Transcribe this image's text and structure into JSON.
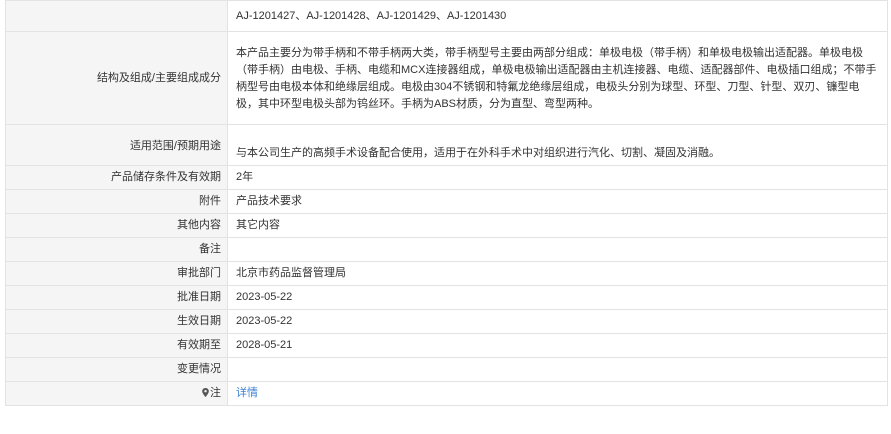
{
  "rows": {
    "model_cont": {
      "label": "",
      "value": "AJ-1201427、AJ-1201428、AJ-1201429、AJ-1201430"
    },
    "structure": {
      "label": "结构及组成/主要组成成分",
      "value": "本产品主要分为带手柄和不带手柄两大类，带手柄型号主要由两部分组成：单极电极（带手柄）和单极电极输出适配器。单极电极（带手柄）由电极、手柄、电缆和MCX连接器组成，单极电极输出适配器由主机连接器、电缆、适配器部件、电极插口组成；不带手柄型号由电极本体和绝缘层组成。电极由304不锈钢和特氟龙绝缘层组成，电极头分别为球型、环型、刀型、针型、双刃、镰型电极，其中环型电极头部为钨丝环。手柄为ABS材质，分为直型、弯型两种。"
    },
    "scope": {
      "label": "适用范围/预期用途",
      "value": "与本公司生产的高频手术设备配合使用，适用于在外科手术中对组织进行汽化、切割、凝固及消融。"
    },
    "storage": {
      "label": "产品储存条件及有效期",
      "value": "2年"
    },
    "attachment": {
      "label": "附件",
      "value": "产品技术要求"
    },
    "other": {
      "label": "其他内容",
      "value": "其它内容"
    },
    "remark": {
      "label": "备注",
      "value": ""
    },
    "dept": {
      "label": "审批部门",
      "value": "北京市药品监督管理局"
    },
    "approve_date": {
      "label": "批准日期",
      "value": "2023-05-22"
    },
    "effective_date": {
      "label": "生效日期",
      "value": "2023-05-22"
    },
    "expire": {
      "label": "有效期至",
      "value": "2028-05-21"
    },
    "change": {
      "label": "变更情况",
      "value": ""
    },
    "note": {
      "label": "注",
      "value": "详情",
      "icon": "location-pin-icon"
    }
  }
}
